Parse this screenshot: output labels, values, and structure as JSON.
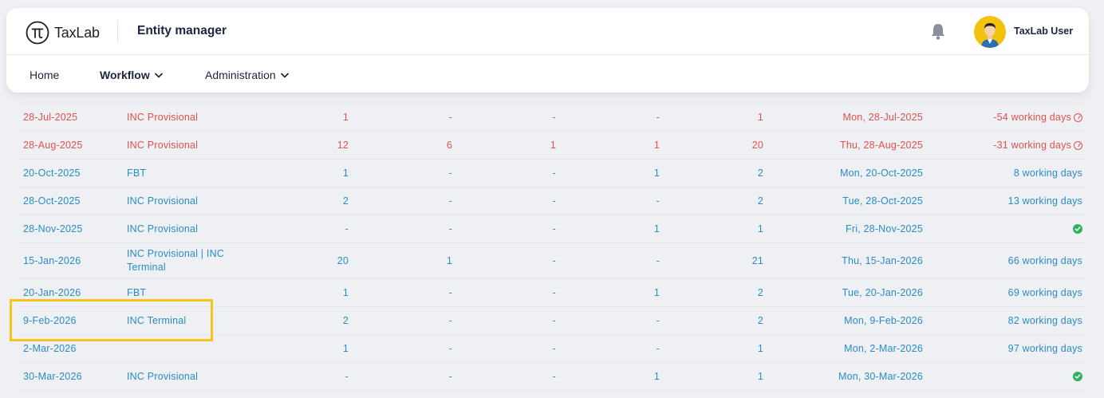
{
  "header": {
    "logo_text": "TaxLab",
    "app_title": "Entity manager",
    "user_name": "TaxLab User"
  },
  "nav": {
    "home": "Home",
    "workflow": "Workflow",
    "administration": "Administration"
  },
  "table": {
    "rows": [
      {
        "date": "28-Jul-2025",
        "type": "INC Provisional",
        "n1": "1",
        "n2": "-",
        "n3": "-",
        "n4": "-",
        "n5": "1",
        "due": "Mon, 28-Jul-2025",
        "working": "-54 working days",
        "status": "overdue"
      },
      {
        "date": "28-Aug-2025",
        "type": "INC Provisional",
        "n1": "12",
        "n2": "6",
        "n3": "1",
        "n4": "1",
        "n5": "20",
        "due": "Thu, 28-Aug-2025",
        "working": "-31 working days",
        "status": "overdue"
      },
      {
        "date": "20-Oct-2025",
        "type": "FBT",
        "n1": "1",
        "n2": "-",
        "n3": "-",
        "n4": "1",
        "n5": "2",
        "due": "Mon, 20-Oct-2025",
        "working": "8 working days",
        "status": "upcoming"
      },
      {
        "date": "28-Oct-2025",
        "type": "INC Provisional",
        "n1": "2",
        "n2": "-",
        "n3": "-",
        "n4": "-",
        "n5": "2",
        "due": "Tue, 28-Oct-2025",
        "working": "13 working days",
        "status": "upcoming"
      },
      {
        "date": "28-Nov-2025",
        "type": "INC Provisional",
        "n1": "-",
        "n2": "-",
        "n3": "-",
        "n4": "1",
        "n5": "1",
        "due": "Fri, 28-Nov-2025",
        "working": "",
        "status": "done"
      },
      {
        "date": "15-Jan-2026",
        "type": "INC Provisional | INC Terminal",
        "n1": "20",
        "n2": "1",
        "n3": "-",
        "n4": "-",
        "n5": "21",
        "due": "Thu, 15-Jan-2026",
        "working": "66 working days",
        "status": "upcoming"
      },
      {
        "date": "20-Jan-2026",
        "type": "FBT",
        "n1": "1",
        "n2": "-",
        "n3": "-",
        "n4": "1",
        "n5": "2",
        "due": "Tue, 20-Jan-2026",
        "working": "69 working days",
        "status": "upcoming"
      },
      {
        "date": "9-Feb-2026",
        "type": "INC Terminal",
        "n1": "2",
        "n2": "-",
        "n3": "-",
        "n4": "-",
        "n5": "2",
        "due": "Mon, 9-Feb-2026",
        "working": "82 working days",
        "status": "upcoming"
      },
      {
        "date": "2-Mar-2026",
        "type": "",
        "n1": "1",
        "n2": "-",
        "n3": "-",
        "n4": "-",
        "n5": "1",
        "due": "Mon, 2-Mar-2026",
        "working": "97 working days",
        "status": "upcoming"
      },
      {
        "date": "30-Mar-2026",
        "type": "INC Provisional",
        "n1": "-",
        "n2": "-",
        "n3": "-",
        "n4": "1",
        "n5": "1",
        "due": "Mon, 30-Mar-2026",
        "working": "",
        "status": "done"
      }
    ]
  },
  "colors": {
    "overdue": "#e0514e",
    "upcoming": "#2a8cc4",
    "done": "#2fb35a",
    "highlight": "#f5c518"
  }
}
